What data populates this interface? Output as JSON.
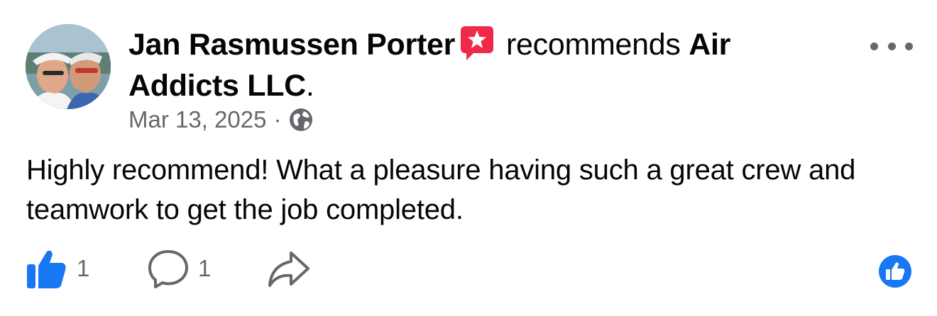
{
  "post": {
    "author_name": "Jan Rasmussen Porter",
    "badge_icon": "recommendation-star-icon",
    "recommends_text": "recommends",
    "page_name": "Air Addicts LLC",
    "page_suffix": ".",
    "date": "Mar 13, 2025",
    "separator": "·",
    "audience_icon": "globe-icon",
    "more_icon": "more-options-icon",
    "body": "Highly recommend! What a pleasure having such a great crew and teamwork to get the job completed."
  },
  "actions": {
    "like_icon": "thumbs-up-icon",
    "like_count": "1",
    "comment_icon": "comment-bubble-icon",
    "comment_count": "1",
    "share_icon": "share-arrow-icon",
    "reaction_icon": "like-reaction-icon"
  },
  "colors": {
    "text": "#050505",
    "secondary": "#65676b",
    "like_blue": "#1877f2",
    "badge_red": "#f0284a"
  }
}
